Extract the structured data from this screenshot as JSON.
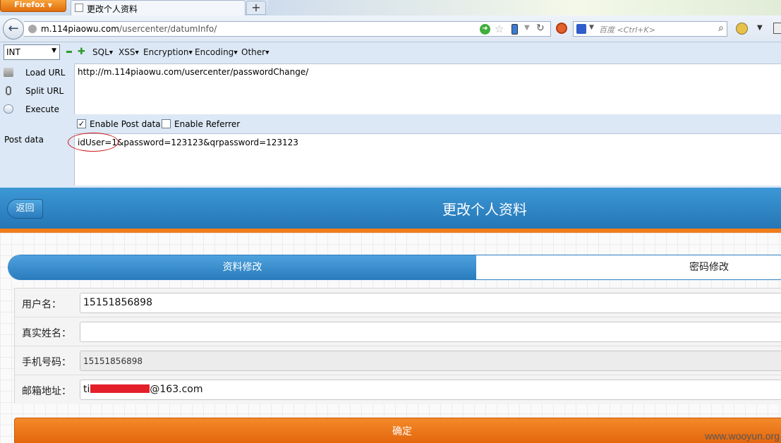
{
  "browser": {
    "menu_button": "Firefox",
    "tab_title": "更改个人资料",
    "new_tab": "+",
    "url_host": "m.114piaowu.com",
    "url_path": "/usercenter/datumInfo/",
    "search_placeholder": "百度 <Ctrl+K>"
  },
  "hackbar": {
    "select_value": "INT",
    "menus": [
      "SQL",
      "XSS",
      "Encryption",
      "Encoding",
      "Other"
    ],
    "side_actions": [
      "Load URL",
      "Split URL",
      "Execute"
    ],
    "url_value": "http://m.114piaowu.com/usercenter/passwordChange/",
    "enable_post_label": "Enable Post data",
    "enable_post_checked": true,
    "enable_referrer_label": "Enable Referrer",
    "enable_referrer_checked": false,
    "post_label": "Post data",
    "post_value": "idUser=1&password=123123&qrpassword=123123"
  },
  "page": {
    "back_label": "返回",
    "title": "更改个人资料",
    "tabs": [
      {
        "label": "资料修改",
        "active": true
      },
      {
        "label": "密码修改",
        "active": false
      }
    ],
    "fields": [
      {
        "label": "用户名：",
        "value": "15151856898"
      },
      {
        "label": "真实姓名：",
        "value": ""
      },
      {
        "label": "手机号码：",
        "value": "15151856898"
      },
      {
        "label": "邮箱地址：",
        "value_prefix": "ti",
        "value_suffix": "@163.com"
      }
    ],
    "submit_label": "确定"
  },
  "watermark": "www.wooyun.org",
  "colors": {
    "header_blue": "#2a7cbd",
    "accent_orange": "#e2640b",
    "annotation_red": "#d01818"
  }
}
